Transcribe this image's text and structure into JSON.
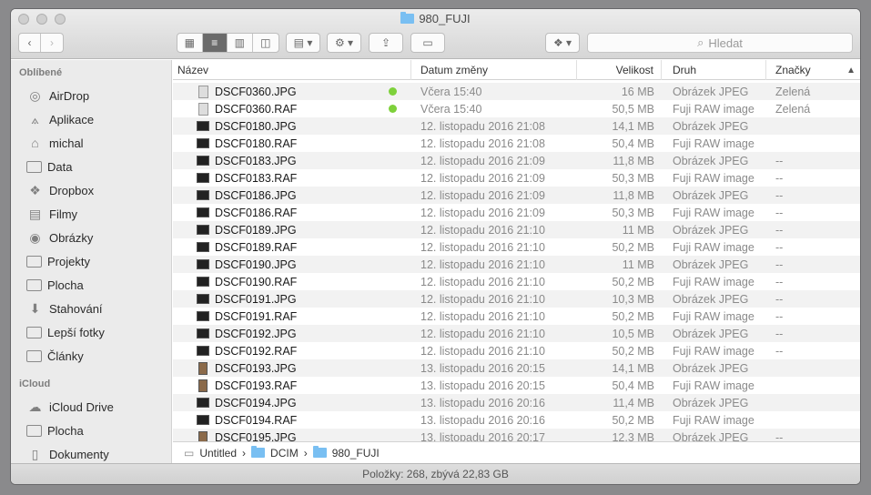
{
  "window": {
    "title": "980_FUJI"
  },
  "toolbar": {
    "search_placeholder": "Hledat",
    "back_icon": "chevron-left-icon",
    "forward_icon": "chevron-right-icon"
  },
  "sidebar": {
    "favorites_header": "Oblíbené",
    "favorites": [
      {
        "label": "AirDrop",
        "icon": "airdrop-icon"
      },
      {
        "label": "Aplikace",
        "icon": "applications-icon"
      },
      {
        "label": "michal",
        "icon": "home-icon"
      },
      {
        "label": "Data",
        "icon": "folder-icon"
      },
      {
        "label": "Dropbox",
        "icon": "dropbox-icon"
      },
      {
        "label": "Filmy",
        "icon": "movies-icon"
      },
      {
        "label": "Obrázky",
        "icon": "camera-icon"
      },
      {
        "label": "Projekty",
        "icon": "folder-icon"
      },
      {
        "label": "Plocha",
        "icon": "desktop-icon"
      },
      {
        "label": "Stahování",
        "icon": "download-icon"
      },
      {
        "label": "Lepší fotky",
        "icon": "folder-icon"
      },
      {
        "label": "Články",
        "icon": "folder-icon"
      }
    ],
    "icloud_header": "iCloud",
    "icloud": [
      {
        "label": "iCloud Drive",
        "icon": "cloud-icon"
      },
      {
        "label": "Plocha",
        "icon": "desktop-icon"
      },
      {
        "label": "Dokumenty",
        "icon": "document-icon"
      }
    ]
  },
  "columns": {
    "name": "Název",
    "date": "Datum změny",
    "size": "Velikost",
    "kind": "Druh",
    "tags": "Značky"
  },
  "files": [
    {
      "name": "DSCF0360.JPG",
      "date": "Včera 15:40",
      "size": "16 MB",
      "kind": "Obrázek JPEG",
      "tag": "Zelená",
      "dot": "#7ed13b",
      "thumb": "doc"
    },
    {
      "name": "DSCF0360.RAF",
      "date": "Včera 15:40",
      "size": "50,5 MB",
      "kind": "Fuji RAW image",
      "tag": "Zelená",
      "dot": "#7ed13b",
      "thumb": "doc"
    },
    {
      "name": "DSCF0180.JPG",
      "date": "12. listopadu 2016 21:08",
      "size": "14,1 MB",
      "kind": "Obrázek JPEG",
      "tag": "",
      "thumb": "dark"
    },
    {
      "name": "DSCF0180.RAF",
      "date": "12. listopadu 2016 21:08",
      "size": "50,4 MB",
      "kind": "Fuji RAW image",
      "tag": "",
      "thumb": "dark"
    },
    {
      "name": "DSCF0183.JPG",
      "date": "12. listopadu 2016 21:09",
      "size": "11,8 MB",
      "kind": "Obrázek JPEG",
      "tag": "--",
      "thumb": "dark"
    },
    {
      "name": "DSCF0183.RAF",
      "date": "12. listopadu 2016 21:09",
      "size": "50,3 MB",
      "kind": "Fuji RAW image",
      "tag": "--",
      "thumb": "dark"
    },
    {
      "name": "DSCF0186.JPG",
      "date": "12. listopadu 2016 21:09",
      "size": "11,8 MB",
      "kind": "Obrázek JPEG",
      "tag": "--",
      "thumb": "dark"
    },
    {
      "name": "DSCF0186.RAF",
      "date": "12. listopadu 2016 21:09",
      "size": "50,3 MB",
      "kind": "Fuji RAW image",
      "tag": "--",
      "thumb": "dark"
    },
    {
      "name": "DSCF0189.JPG",
      "date": "12. listopadu 2016 21:10",
      "size": "11 MB",
      "kind": "Obrázek JPEG",
      "tag": "--",
      "thumb": "dark"
    },
    {
      "name": "DSCF0189.RAF",
      "date": "12. listopadu 2016 21:10",
      "size": "50,2 MB",
      "kind": "Fuji RAW image",
      "tag": "--",
      "thumb": "dark"
    },
    {
      "name": "DSCF0190.JPG",
      "date": "12. listopadu 2016 21:10",
      "size": "11 MB",
      "kind": "Obrázek JPEG",
      "tag": "--",
      "thumb": "dark"
    },
    {
      "name": "DSCF0190.RAF",
      "date": "12. listopadu 2016 21:10",
      "size": "50,2 MB",
      "kind": "Fuji RAW image",
      "tag": "--",
      "thumb": "dark"
    },
    {
      "name": "DSCF0191.JPG",
      "date": "12. listopadu 2016 21:10",
      "size": "10,3 MB",
      "kind": "Obrázek JPEG",
      "tag": "--",
      "thumb": "dark"
    },
    {
      "name": "DSCF0191.RAF",
      "date": "12. listopadu 2016 21:10",
      "size": "50,2 MB",
      "kind": "Fuji RAW image",
      "tag": "--",
      "thumb": "dark"
    },
    {
      "name": "DSCF0192.JPG",
      "date": "12. listopadu 2016 21:10",
      "size": "10,5 MB",
      "kind": "Obrázek JPEG",
      "tag": "--",
      "thumb": "dark"
    },
    {
      "name": "DSCF0192.RAF",
      "date": "12. listopadu 2016 21:10",
      "size": "50,2 MB",
      "kind": "Fuji RAW image",
      "tag": "--",
      "thumb": "dark"
    },
    {
      "name": "DSCF0193.JPG",
      "date": "13. listopadu 2016 20:15",
      "size": "14,1 MB",
      "kind": "Obrázek JPEG",
      "tag": "",
      "thumb": "tall"
    },
    {
      "name": "DSCF0193.RAF",
      "date": "13. listopadu 2016 20:15",
      "size": "50,4 MB",
      "kind": "Fuji RAW image",
      "tag": "",
      "thumb": "tall"
    },
    {
      "name": "DSCF0194.JPG",
      "date": "13. listopadu 2016 20:16",
      "size": "11,4 MB",
      "kind": "Obrázek JPEG",
      "tag": "",
      "thumb": "dark"
    },
    {
      "name": "DSCF0194.RAF",
      "date": "13. listopadu 2016 20:16",
      "size": "50,2 MB",
      "kind": "Fuji RAW image",
      "tag": "",
      "thumb": "dark"
    },
    {
      "name": "DSCF0195.JPG",
      "date": "13. listopadu 2016 20:17",
      "size": "12,3 MB",
      "kind": "Obrázek JPEG",
      "tag": "--",
      "thumb": "tall"
    }
  ],
  "pathbar": [
    "Untitled",
    "DCIM",
    "980_FUJI"
  ],
  "status": "Položky: 268, zbývá 22,83 GB"
}
